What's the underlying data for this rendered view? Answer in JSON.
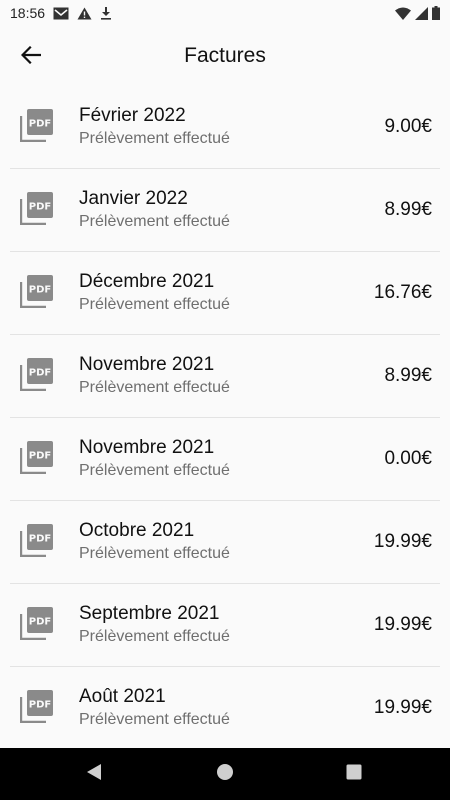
{
  "status_bar": {
    "time": "18:56",
    "icons": [
      "gmail-icon",
      "warning-icon",
      "download-icon",
      "wifi-icon",
      "signal-icon",
      "battery-icon"
    ]
  },
  "header": {
    "title": "Factures",
    "back_icon": "arrow-left-icon"
  },
  "invoices": [
    {
      "period": "Février 2022",
      "status": "Prélèvement effectué",
      "amount": "9.00€"
    },
    {
      "period": "Janvier 2022",
      "status": "Prélèvement effectué",
      "amount": "8.99€"
    },
    {
      "period": "Décembre 2021",
      "status": "Prélèvement effectué",
      "amount": "16.76€"
    },
    {
      "period": "Novembre 2021",
      "status": "Prélèvement effectué",
      "amount": "8.99€"
    },
    {
      "period": "Novembre 2021",
      "status": "Prélèvement effectué",
      "amount": "0.00€"
    },
    {
      "period": "Octobre 2021",
      "status": "Prélèvement effectué",
      "amount": "19.99€"
    },
    {
      "period": "Septembre 2021",
      "status": "Prélèvement effectué",
      "amount": "19.99€"
    },
    {
      "period": "Août 2021",
      "status": "Prélèvement effectué",
      "amount": "19.99€"
    }
  ],
  "nav_bar": {
    "buttons": [
      "back-triangle-icon",
      "home-circle-icon",
      "recents-square-icon"
    ]
  },
  "colors": {
    "background": "#fafafa",
    "icon_gray": "#8a8a8a",
    "subtitle_gray": "#6f6f6f",
    "nav_background": "#000000"
  }
}
